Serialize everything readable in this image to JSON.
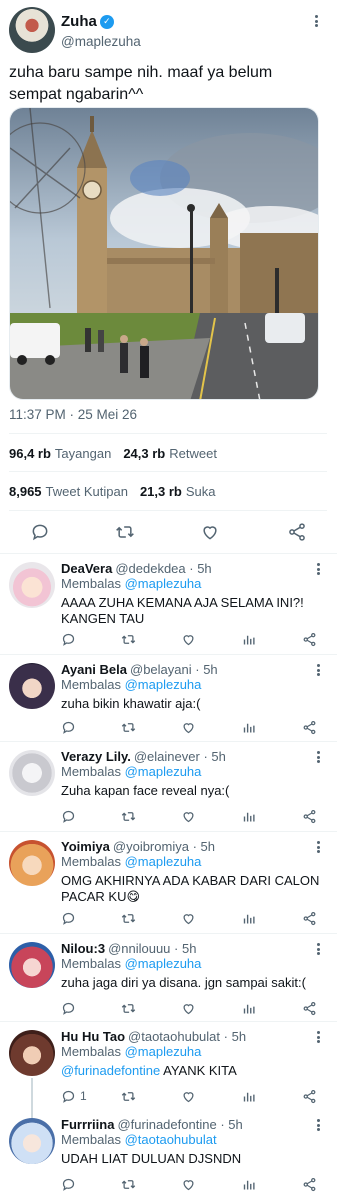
{
  "tweet": {
    "name": "Zuha",
    "verified_mark": "✓",
    "handle": "@maplezuha",
    "text": "zuha baru sampe nih. maaf ya belum sempat ngabarin^^",
    "timestamp": "11:37 PM · 25 Mei 26",
    "stats": {
      "views_count": "96,4 rb",
      "views_label": "Tayangan",
      "retweets_count": "24,3 rb",
      "retweets_label": "Retweet",
      "quotes_count": "8,965",
      "quotes_label": "Tweet Kutipan",
      "likes_count": "21,3 rb",
      "likes_label": "Suka"
    },
    "photo_icon": "big-ben-photo"
  },
  "replies": [
    {
      "name": "DeaVera",
      "handle": "@dedekdea",
      "time": "· 5h",
      "replying_prefix": "Membalas",
      "replying_to": "@maplezuha",
      "text": "AAAA ZUHA KEMANA AJA SELAMA INI?! KANGEN TAU",
      "mention": "",
      "reply_count": "",
      "avatar_color": "#f3d7e0"
    },
    {
      "name": "Ayani Bela",
      "handle": "@belayani",
      "time": "· 5h",
      "replying_prefix": "Membalas",
      "replying_to": "@maplezuha",
      "text": "zuha bikin khawatir aja:(",
      "mention": "",
      "reply_count": "",
      "avatar_color": "#3a2f4a"
    },
    {
      "name": "Verazy Lily.",
      "handle": "@elainever",
      "time": "· 5h",
      "replying_prefix": "Membalas",
      "replying_to": "@maplezuha",
      "text": "Zuha kapan face reveal nya:(",
      "mention": "",
      "reply_count": "",
      "avatar_color": "#d9d9de"
    },
    {
      "name": "Yoimiya",
      "handle": "@yoibromiya",
      "time": "· 5h",
      "replying_prefix": "Membalas",
      "replying_to": "@maplezuha",
      "text": "OMG AKHIRNYA ADA KABAR DARI CALON PACAR KU😋",
      "mention": "",
      "reply_count": "",
      "avatar_color": "#e9a25a"
    },
    {
      "name": "Nilou:3",
      "handle": "@nnilouuu",
      "time": "· 5h",
      "replying_prefix": "Membalas",
      "replying_to": "@maplezuha",
      "text": "zuha jaga diri ya disana. jgn sampai sakit:(",
      "mention": "",
      "reply_count": "",
      "avatar_color": "#c8455a"
    },
    {
      "name": "Hu Hu Tao",
      "handle": "@taotaohubulat",
      "time": "· 5h",
      "replying_prefix": "Membalas",
      "replying_to": "@maplezuha",
      "text": " AYANK KITA",
      "mention": "@furinadefontine",
      "reply_count": "1",
      "avatar_color": "#6e3a2e"
    },
    {
      "name": "Furrriina",
      "handle": "@furinadefontine",
      "time": "· 5h",
      "replying_prefix": "Membalas",
      "replying_to": "@taotaohubulat",
      "text": "UDAH LIAT DULUAN DJSNDN",
      "mention": "",
      "reply_count": "",
      "avatar_color": "#cfe0f5"
    }
  ],
  "icons": {
    "reply": "reply-icon",
    "retweet": "retweet-icon",
    "like": "like-icon",
    "views": "views-icon",
    "share": "share-icon",
    "more": "more-icon"
  },
  "colors": {
    "accent": "#1d9bf0",
    "text_secondary": "#536471",
    "divider": "#eff3f4"
  }
}
